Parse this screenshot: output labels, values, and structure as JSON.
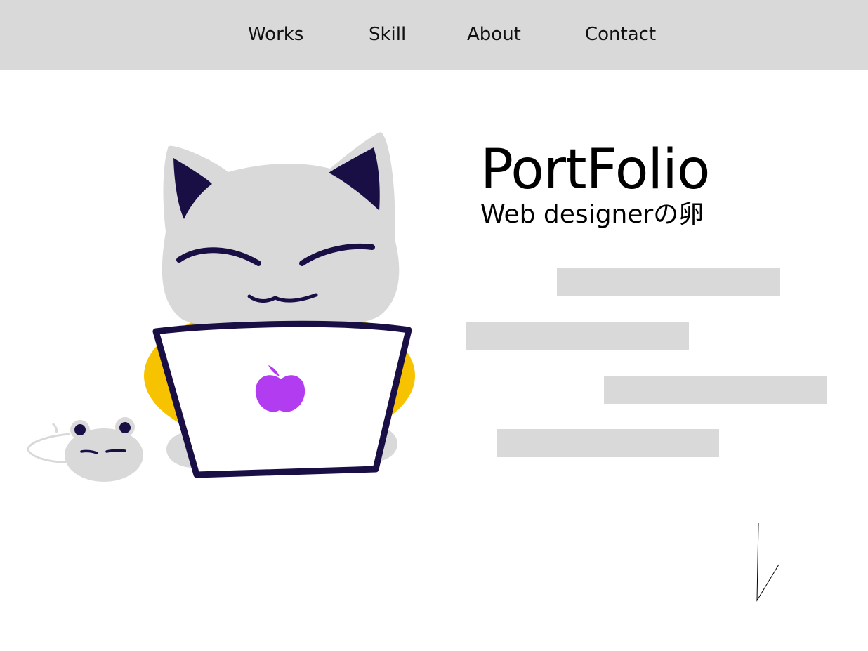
{
  "nav": {
    "items": [
      {
        "label": "Works"
      },
      {
        "label": "Skill"
      },
      {
        "label": "About"
      },
      {
        "label": "Contact"
      }
    ]
  },
  "hero": {
    "title": "PortFolio",
    "subtitle": "Web designerの卵",
    "illustration": "cat-with-laptop-and-mouse",
    "colors": {
      "cat_body": "#d9d9d9",
      "outline": "#1a0f45",
      "shirt": "#f7c300",
      "apple_logo": "#b23cf0"
    }
  },
  "colors": {
    "nav_background": "#d9d9d9",
    "placeholder": "#d9d9d9"
  },
  "scroll_indicator_icon": "scroll-down-arrow-icon"
}
